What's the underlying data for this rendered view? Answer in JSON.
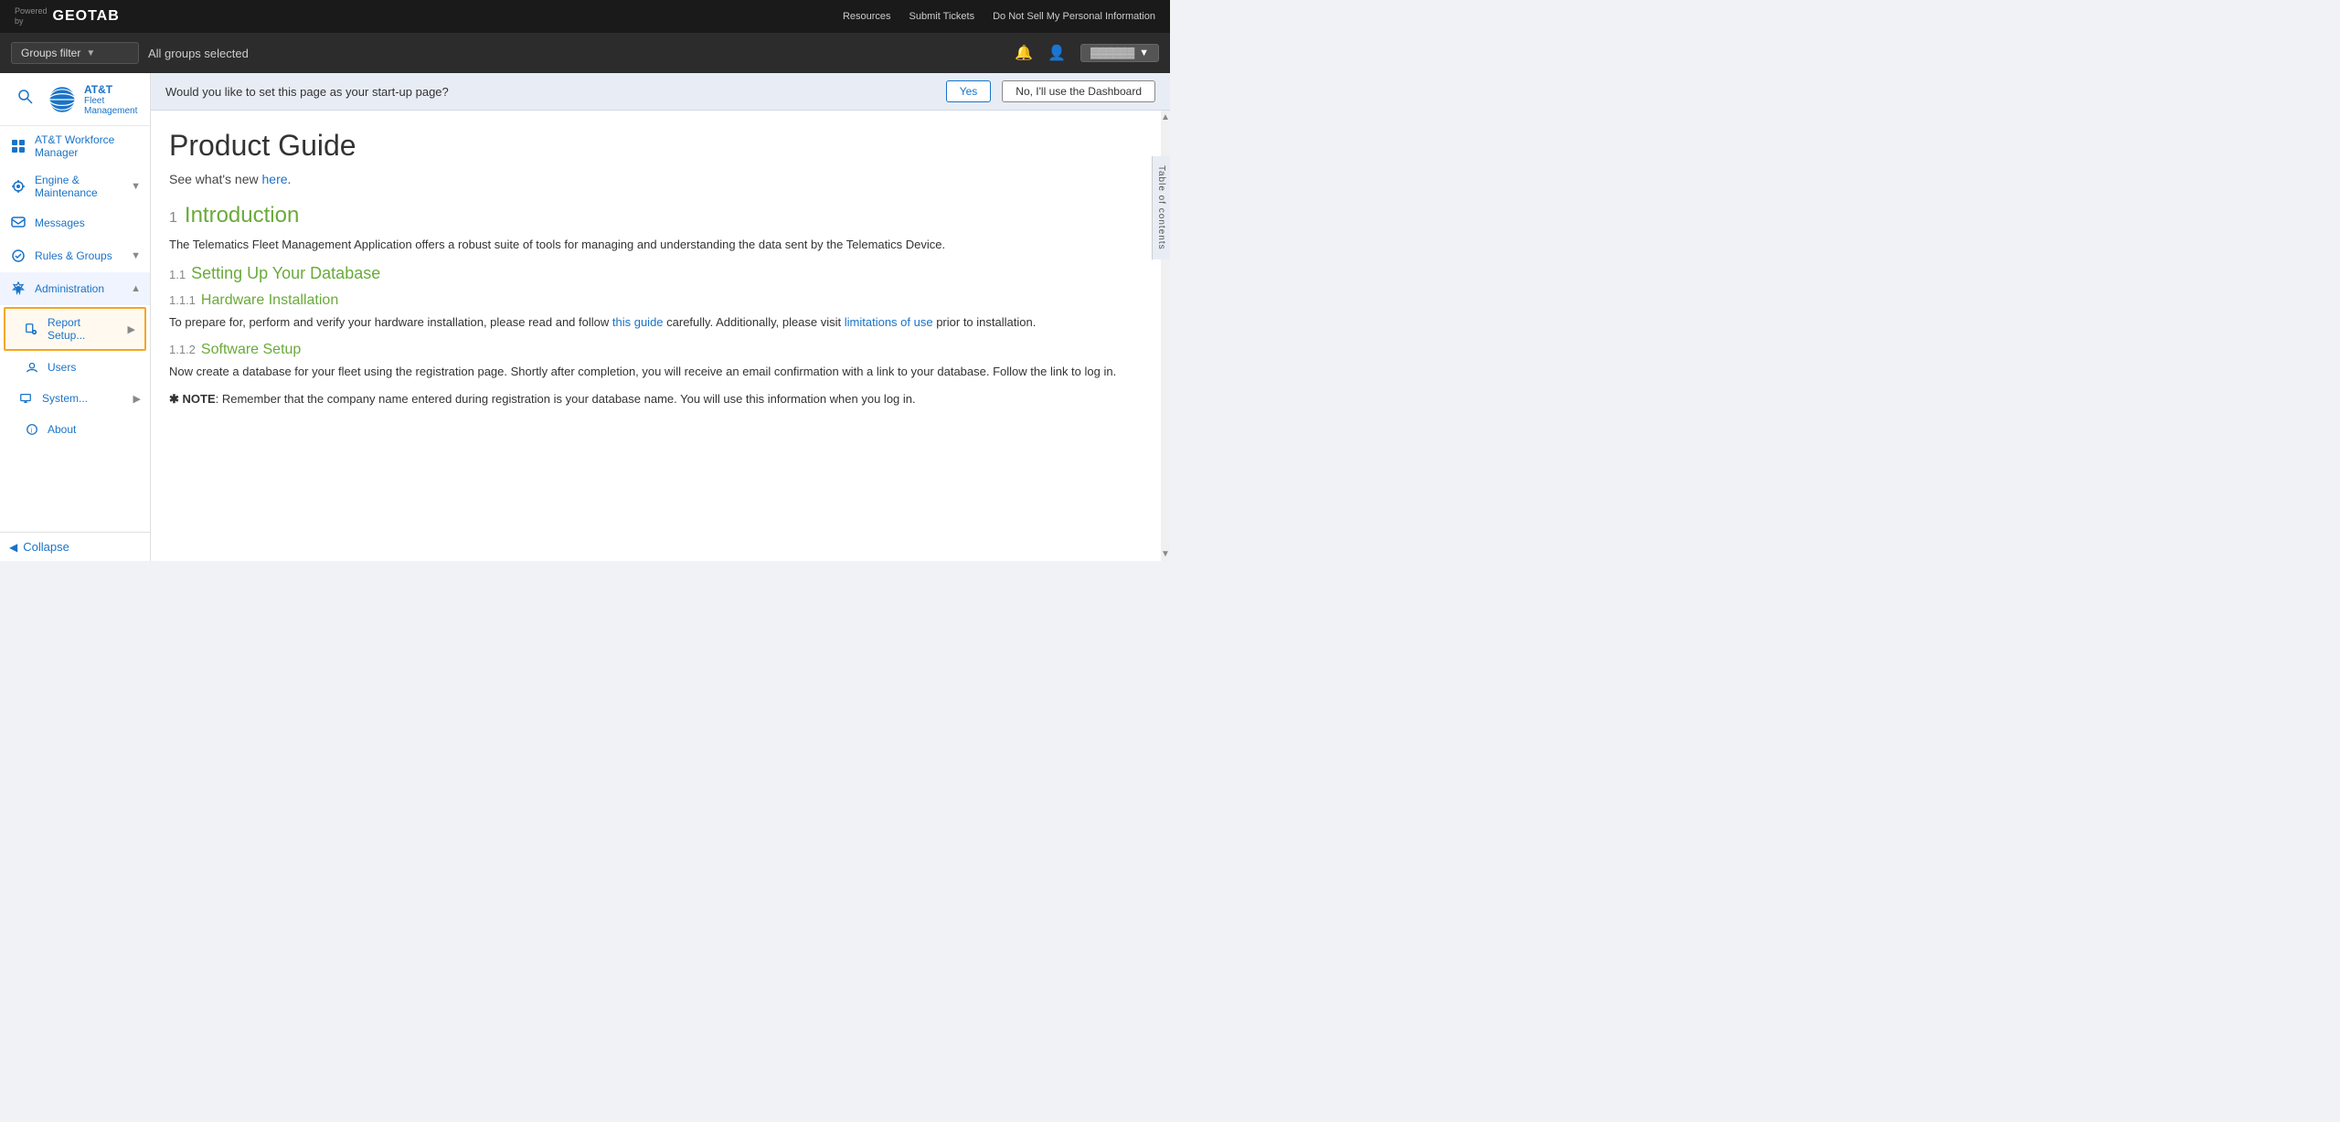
{
  "topbar": {
    "powered_by": "Powered\nby",
    "logo": "GEOTAB",
    "links": [
      "Resources",
      "Submit Tickets",
      "Do Not Sell My Personal Information"
    ]
  },
  "filterbar": {
    "groups_filter_label": "Groups filter",
    "all_groups_selected": "All groups selected"
  },
  "sidebar": {
    "app_name": "AT&T",
    "app_subtitle": "Fleet Management",
    "items": [
      {
        "label": "AT&T Workforce Manager",
        "icon": "grid",
        "has_chevron": false
      },
      {
        "label": "Engine & Maintenance",
        "icon": "engine",
        "has_chevron": true
      },
      {
        "label": "Messages",
        "icon": "message",
        "has_chevron": false
      },
      {
        "label": "Rules & Groups",
        "icon": "rules",
        "has_chevron": true
      },
      {
        "label": "Administration",
        "icon": "admin",
        "has_chevron": true,
        "active": true
      }
    ],
    "subitems": [
      {
        "label": "Report Setup...",
        "icon": "report",
        "has_chevron": true,
        "selected": true
      },
      {
        "label": "Users",
        "icon": "users"
      },
      {
        "label": "System...",
        "icon": "system",
        "has_chevron": true
      },
      {
        "label": "About",
        "icon": "about"
      }
    ],
    "collapse_label": "Collapse"
  },
  "startup_banner": {
    "question": "Would you like to set this page as your start-up page?",
    "yes_label": "Yes",
    "no_label": "No, I'll use the Dashboard"
  },
  "toc": {
    "label": "Table of contents"
  },
  "document": {
    "title": "Product Guide",
    "subtitle_prefix": "See what's new ",
    "subtitle_link": "here",
    "subtitle_suffix": ".",
    "sections": [
      {
        "num": "1",
        "title": "Introduction",
        "body": "The Telematics Fleet Management Application offers a robust suite of tools for managing and understanding the data sent by the Telematics Device.",
        "subsections": [
          {
            "num": "1.1",
            "title": "Setting Up Your Database",
            "subsubsections": [
              {
                "num": "1.1.1",
                "title": "Hardware Installation",
                "body_prefix": "To prepare for, perform and verify your hardware installation, please read and follow ",
                "body_link1": "this guide",
                "body_mid": " carefully. Additionally, please visit ",
                "body_link2": "limitations of use",
                "body_suffix": " prior to installation."
              },
              {
                "num": "1.1.2",
                "title": "Software Setup",
                "body": "Now create a database for your fleet using the registration page. Shortly after completion, you will receive an email confirmation with a link to your database. Follow the link to log in.",
                "note": "NOTE: Remember that the company name entered during registration is your database name. You will use this information when you log in."
              }
            ]
          }
        ]
      }
    ]
  }
}
